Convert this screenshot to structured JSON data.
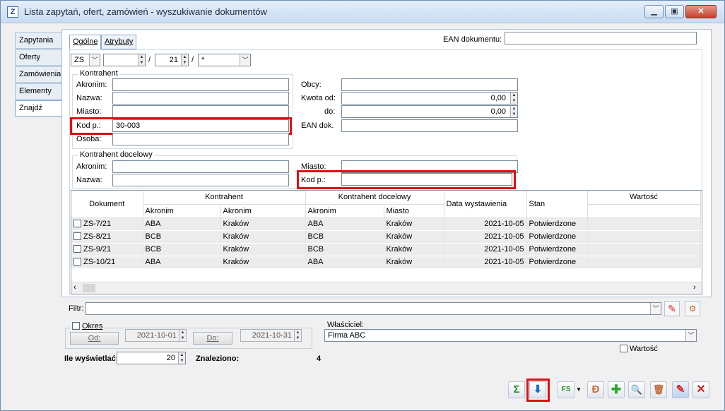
{
  "window": {
    "title": "Lista zapytań, ofert, zamówień - wyszukiwanie dokumentów",
    "icon": "Z",
    "min": "▁",
    "max": "▣",
    "close": "✕"
  },
  "left_tabs": [
    "Zapytania",
    "Oferty",
    "Zamówienia",
    "Elementy",
    "Znajdź"
  ],
  "top_tabs": {
    "general": "Ogólne",
    "attributes": "Atrybuty"
  },
  "ean_doc_label": "EAN dokumentu:",
  "ean_doc_value": "",
  "doc_filter": {
    "type": "ZS",
    "slash1": "/",
    "number": "",
    "month": "21",
    "slash2": "/",
    "series": "*"
  },
  "kontrahent": {
    "legend": "Kontrahent",
    "akronim_label": "Akronim:",
    "akronim": "",
    "nazwa_label": "Nazwa:",
    "nazwa": "",
    "miasto_label": "Miasto:",
    "miasto": "",
    "kod_label": "Kod p.:",
    "kod": "30-003",
    "osoba_label": "Osoba:",
    "osoba": ""
  },
  "right_fields": {
    "obcy_label": "Obcy:",
    "obcy": "",
    "kwota_od_label": "Kwota od:",
    "kwota_od": "0,00",
    "do_label": "do:",
    "do": "0,00",
    "ean_label": "EAN dok.",
    "ean": ""
  },
  "docelowy": {
    "legend": "Kontrahent docelowy",
    "akronim_label": "Akronim:",
    "akronim": "",
    "nazwa_label": "Nazwa:",
    "nazwa": "",
    "miasto_label": "Miasto:",
    "miasto": "",
    "kod_label": "Kod p.:",
    "kod": ""
  },
  "table": {
    "headers": {
      "dokument": "Dokument",
      "kontrahent": "Kontrahent",
      "k_akronim": "Akronim",
      "k_miasto": "Akronim",
      "docelowy": "Kontrahent docelowy",
      "d_akronim": "Akronim",
      "d_miasto": "Miasto",
      "data": "Data wystawienia",
      "stan": "Stan",
      "wartosc": "Wartość"
    },
    "rows": [
      {
        "dok": "ZS-7/21",
        "k_akr": "ABA",
        "k_mia": "Kraków",
        "d_akr": "ABA",
        "d_mia": "Kraków",
        "data": "2021-10-05",
        "stan": "Potwierdzone",
        "wart": ""
      },
      {
        "dok": "ZS-8/21",
        "k_akr": "BCB",
        "k_mia": "Kraków",
        "d_akr": "BCB",
        "d_mia": "Kraków",
        "data": "2021-10-05",
        "stan": "Potwierdzone",
        "wart": ""
      },
      {
        "dok": "ZS-9/21",
        "k_akr": "BCB",
        "k_mia": "Kraków",
        "d_akr": "BCB",
        "d_mia": "Kraków",
        "data": "2021-10-05",
        "stan": "Potwierdzone",
        "wart": ""
      },
      {
        "dok": "ZS-10/21",
        "k_akr": "ABA",
        "k_mia": "Kraków",
        "d_akr": "ABA",
        "d_mia": "Kraków",
        "data": "2021-10-05",
        "stan": "Potwierdzone",
        "wart": ""
      }
    ]
  },
  "filter": {
    "label": "Filtr:",
    "value": ""
  },
  "period": {
    "label": "Okres",
    "od_btn": "Od:",
    "od": "2021-10-01",
    "do_btn": "Do:",
    "do": "2021-10-31"
  },
  "owner": {
    "label": "Właściciel:",
    "value": "Firma ABC"
  },
  "value_check": "Wartość",
  "show_count": {
    "label": "Ile wyświetlać:",
    "value": "20"
  },
  "found": {
    "label": "Znaleziono:",
    "value": "4"
  },
  "icons": {
    "sum": "Σ",
    "export": "⬇",
    "fs": "FS",
    "add": "✚",
    "search": "🔍",
    "delete": "🗑",
    "edit": "✎",
    "close": "✕"
  },
  "colors": {
    "highlight": "#e01010",
    "accent": "#1c6fd1"
  }
}
